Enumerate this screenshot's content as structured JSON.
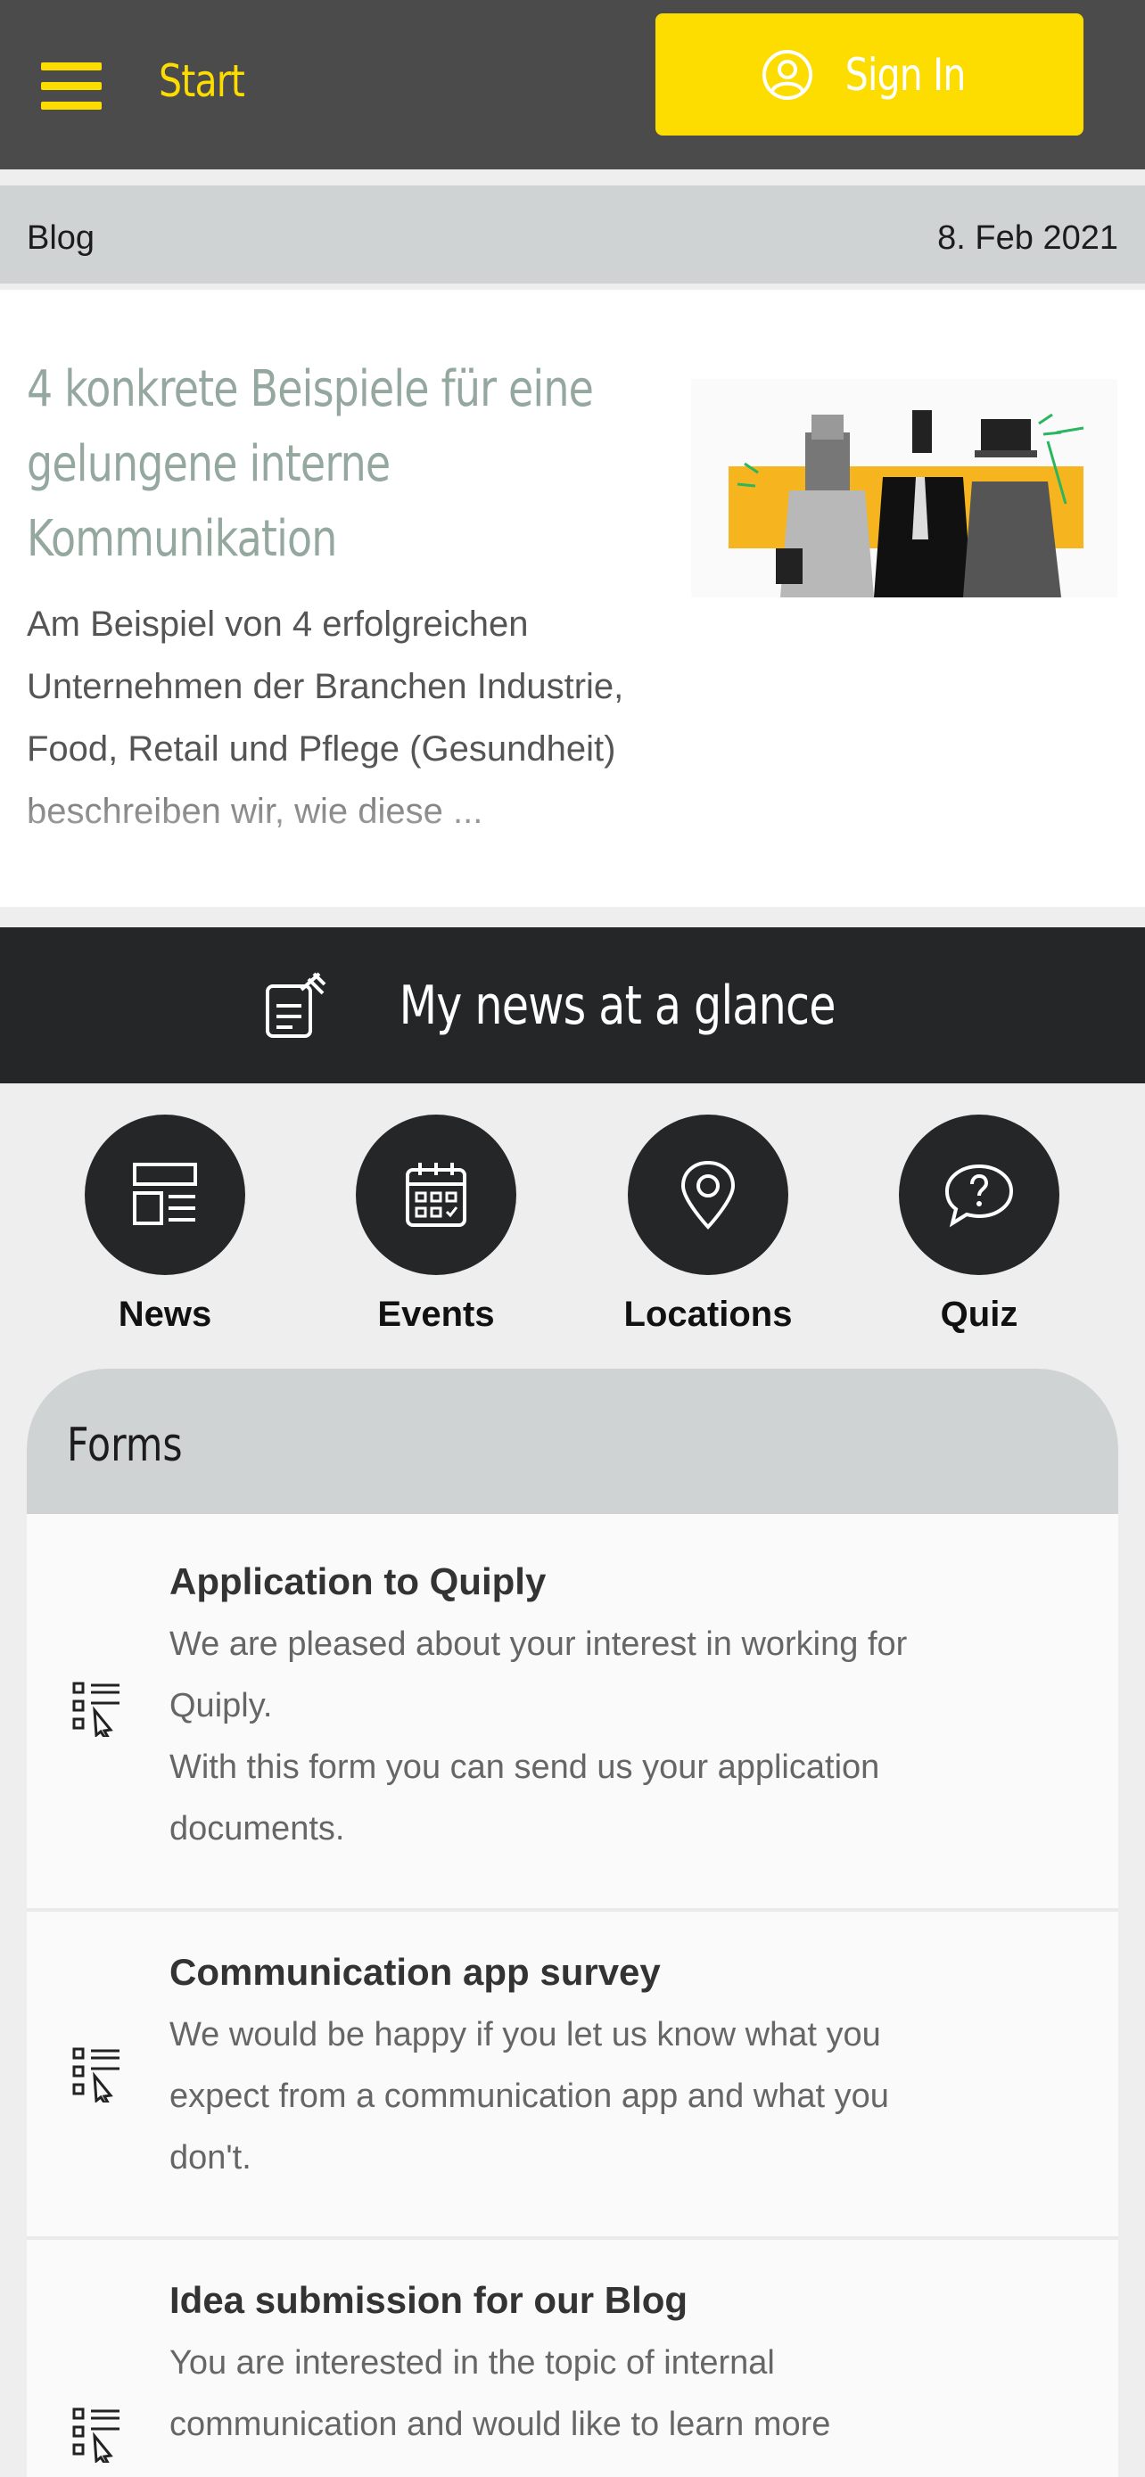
{
  "header": {
    "menu_icon": "hamburger-icon",
    "start_label": "Start",
    "signin_label": "Sign In",
    "signin_icon": "user-circle-icon"
  },
  "colors": {
    "header_bg": "#4b4b4b",
    "accent": "#fddc00",
    "banner_bg": "#252627",
    "category_bar": "#d0d3d4",
    "article_title": "#94a8a0"
  },
  "blog": {
    "category": "Blog",
    "date": "8. Feb 2021",
    "title": "4 konkrete Beispiele für eine gelungene interne Kommunikation",
    "excerpt": "Am Beispiel von 4 erfolgreichen Unternehmen der Branchen Industrie, Food, Retail und Pflege (Gesundheit) beschreiben wir, wie diese ...",
    "image": "people-with-device-heads-illustration"
  },
  "banner": {
    "title": "My news at a glance",
    "icon": "news-edit-icon"
  },
  "quick_nav": [
    {
      "label": "News",
      "icon": "news-layout-icon"
    },
    {
      "label": "Events",
      "icon": "calendar-icon"
    },
    {
      "label": "Locations",
      "icon": "location-pin-icon"
    },
    {
      "label": "Quiz",
      "icon": "question-bubble-icon"
    }
  ],
  "forms": {
    "title": "Forms",
    "items": [
      {
        "title": "Application to Quiply",
        "desc": "We are pleased about your interest in working for Quiply.\nWith this form you can send us your application documents.",
        "icon": "form-checklist-icon"
      },
      {
        "title": "Communication app survey",
        "desc": "We would be happy if you let us know what you expect from a communication app and what you don't.",
        "icon": "form-checklist-icon"
      },
      {
        "title": "Idea submission for our Blog",
        "desc": "You are interested in the topic of internal communication and would like to learn more",
        "icon": "form-checklist-icon"
      }
    ]
  }
}
